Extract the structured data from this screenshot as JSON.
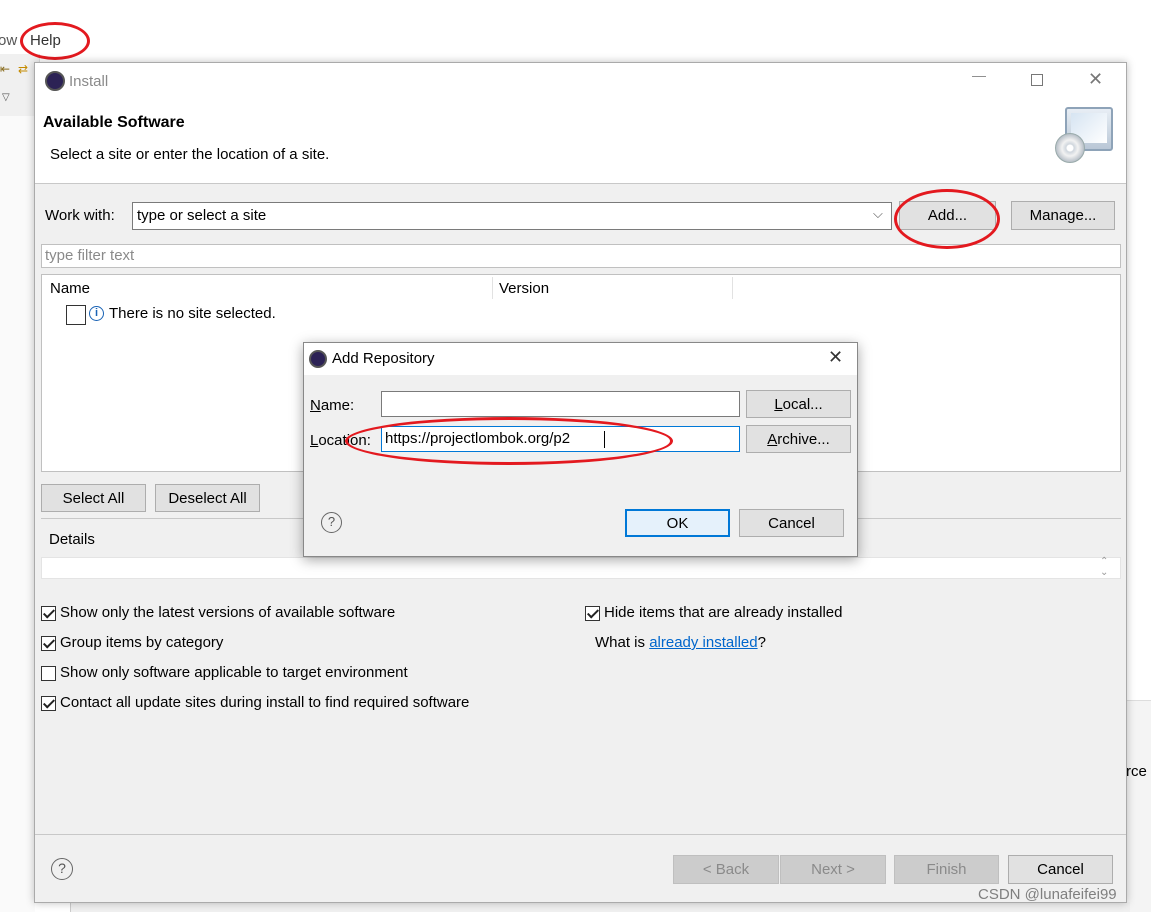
{
  "background_ide": {
    "menu_partial": "ow",
    "menu_help": "Help",
    "right_partial_text": "rce"
  },
  "install_dialog": {
    "title": "Install",
    "header_title": "Available Software",
    "header_subtitle": "Select a site or enter the location of a site.",
    "work_with_label": "Work with:",
    "work_with_value": "type or select a site",
    "add_button": "Add...",
    "manage_button": "Manage...",
    "filter_placeholder": "type filter text",
    "table_headers": [
      "Name",
      "Version"
    ],
    "no_site_message": "There is no site selected.",
    "select_all": "Select All",
    "deselect_all": "Deselect All",
    "details_label": "Details",
    "options": [
      {
        "label": "Show only the latest versions of available software",
        "checked": true
      },
      {
        "label": "Group items by category",
        "checked": true
      },
      {
        "label": "Show only software applicable to target environment",
        "checked": false
      },
      {
        "label": "Contact all update sites during install to find required software",
        "checked": true
      }
    ],
    "hide_installed": {
      "label": "Hide items that are already installed",
      "checked": true
    },
    "what_is_prefix": "What is ",
    "what_is_link": "already installed",
    "what_is_suffix": "?",
    "back_button": "< Back",
    "next_button": "Next >",
    "finish_button": "Finish",
    "cancel_button": "Cancel"
  },
  "add_repo_dialog": {
    "title": "Add Repository",
    "name_label_u": "N",
    "name_label_rest": "ame:",
    "name_value": "",
    "location_label_u": "L",
    "location_label_rest": "ocation:",
    "location_value": "https://projectlombok.org/p2",
    "local_button_u": "L",
    "local_button_rest": "ocal...",
    "archive_button_u": "A",
    "archive_button_rest": "rchive...",
    "ok_button": "OK",
    "cancel_button": "Cancel"
  },
  "watermark": "CSDN @lunafeifei99",
  "colors": {
    "annotation_red": "#e3191f",
    "link_blue": "#0066cc",
    "focus_blue": "#0078d7"
  }
}
